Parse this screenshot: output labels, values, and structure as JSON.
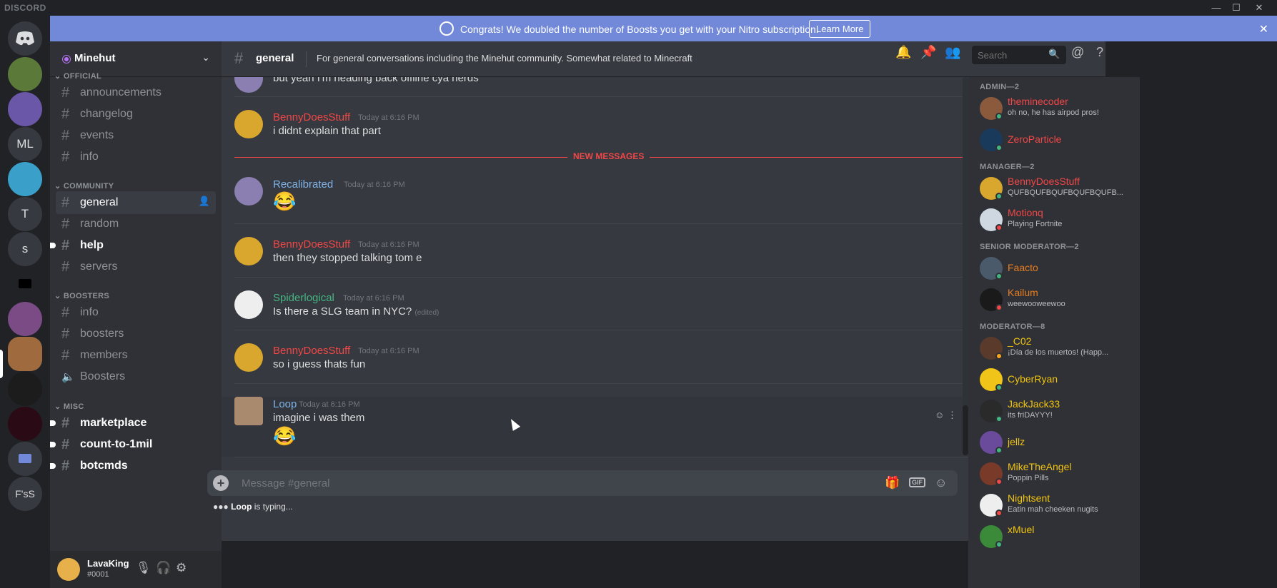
{
  "window": {
    "brand": "DISCORD",
    "min": "—",
    "max": "☐",
    "close": "✕"
  },
  "banner": {
    "text": "Congrats! We doubled the number of Boosts you get with your Nitro subscription.",
    "button": "Learn More",
    "close": "✕"
  },
  "servers": [
    {
      "label": "",
      "color": "#36393f",
      "name": "home"
    },
    {
      "label": "",
      "color": "#5b7a3a",
      "name": "server-1"
    },
    {
      "label": "",
      "color": "#6a57a8",
      "name": "server-2"
    },
    {
      "label": "ML",
      "color": "#36393f",
      "name": "server-ml"
    },
    {
      "label": "",
      "color": "#3aa0c9",
      "name": "server-4"
    },
    {
      "label": "T",
      "color": "#36393f",
      "name": "server-t"
    },
    {
      "label": "s",
      "color": "#36393f",
      "name": "server-s"
    },
    {
      "label": "",
      "color": "#202225",
      "name": "folder-1"
    },
    {
      "label": "",
      "color": "#7b4b86",
      "name": "server-8"
    },
    {
      "label": "",
      "color": "#a06a3f",
      "name": "server-9"
    },
    {
      "label": "",
      "color": "#1c1c1c",
      "name": "server-10"
    },
    {
      "label": "",
      "color": "#2a0a14",
      "name": "server-11"
    },
    {
      "label": "",
      "color": "#36393f",
      "name": "folder-2"
    },
    {
      "label": "F'sS",
      "color": "#36393f",
      "name": "server-fss"
    }
  ],
  "guild": {
    "name": "Minehut",
    "chevron": "⌄"
  },
  "categories": {
    "official": "OFFICIAL",
    "community": "COMMUNITY",
    "boosters": "BOOSTERS",
    "misc": "MISC"
  },
  "channels": {
    "announcements": "announcements",
    "changelog": "changelog",
    "events": "events",
    "info": "info",
    "general": "general",
    "random": "random",
    "help": "help",
    "servers": "servers",
    "b_info": "info",
    "boosters": "boosters",
    "members": "members",
    "voice_boosters": "Boosters",
    "marketplace": "marketplace",
    "count": "count-to-1mil",
    "botcmds": "botcmds"
  },
  "user": {
    "name": "LavaKing",
    "tag": "#0001"
  },
  "header": {
    "channel": "general",
    "topic": "For general conversations including the Minehut community. Somewhat related to Minecraft",
    "search_placeholder": "Search"
  },
  "messages": [
    {
      "author": "",
      "text": "but yeah I'm heading back offline cya nerds"
    },
    {
      "author": "BennyDoesStuff",
      "time": "Today at 6:16 PM",
      "text": "i didnt explain that part"
    },
    {
      "author": "Recalibrated",
      "time": "Today at 6:16 PM",
      "emoji": "😂"
    },
    {
      "author": "BennyDoesStuff",
      "time": "Today at 6:16 PM",
      "text": "then they stopped talking tom e"
    },
    {
      "author": "Spiderlogical",
      "time": "Today at 6:16 PM",
      "text": "Is there a SLG team in NYC?",
      "edited": "(edited)"
    },
    {
      "author": "BennyDoesStuff",
      "time": "Today at 6:16 PM",
      "text": "so i guess thats fun"
    },
    {
      "author": "Loop",
      "time": "Today at 6:16 PM",
      "text": "imagine i was them",
      "emoji": "😂"
    }
  ],
  "new_messages": "NEW MESSAGES",
  "composer": {
    "placeholder": "Message #general"
  },
  "typing": {
    "user": "Loop",
    "text": " is typing..."
  },
  "member_roles": {
    "admin": "ADMIN—2",
    "manager": "MANAGER—2",
    "senior": "SENIOR MODERATOR—2",
    "moderator": "MODERATOR—8"
  },
  "members": [
    {
      "name": "theminecoder",
      "activity": "oh no, he has airpod pros!",
      "color": "#f04747"
    },
    {
      "name": "ZeroParticle",
      "activity": "",
      "color": "#f04747"
    },
    {
      "name": "BennyDoesStuff",
      "activity": "QUFBQUFBQUFBQUFBQUFB...",
      "color": "#f04747"
    },
    {
      "name": "Motionq",
      "activity": "Playing Fortnite",
      "color": "#f04747"
    },
    {
      "name": "Faacto",
      "activity": "",
      "color": "#e67e22"
    },
    {
      "name": "Kailum",
      "activity": "weewooweewoo",
      "color": "#e67e22"
    },
    {
      "name": "_C02",
      "activity": "¡Día de los muertos! (Happ...",
      "color": "#f1c40f"
    },
    {
      "name": "CyberRyan",
      "activity": "",
      "color": "#f1c40f"
    },
    {
      "name": "JackJack33",
      "activity": "its friDAYYY!",
      "color": "#f1c40f"
    },
    {
      "name": "jellz",
      "activity": "",
      "color": "#f1c40f"
    },
    {
      "name": "MikeTheAngel",
      "activity": "Poppin Pills",
      "color": "#f1c40f"
    },
    {
      "name": "Nightsent",
      "activity": "Eatin mah cheeken nugits",
      "color": "#f1c40f"
    },
    {
      "name": "xMuel",
      "activity": "",
      "color": "#f1c40f"
    }
  ]
}
